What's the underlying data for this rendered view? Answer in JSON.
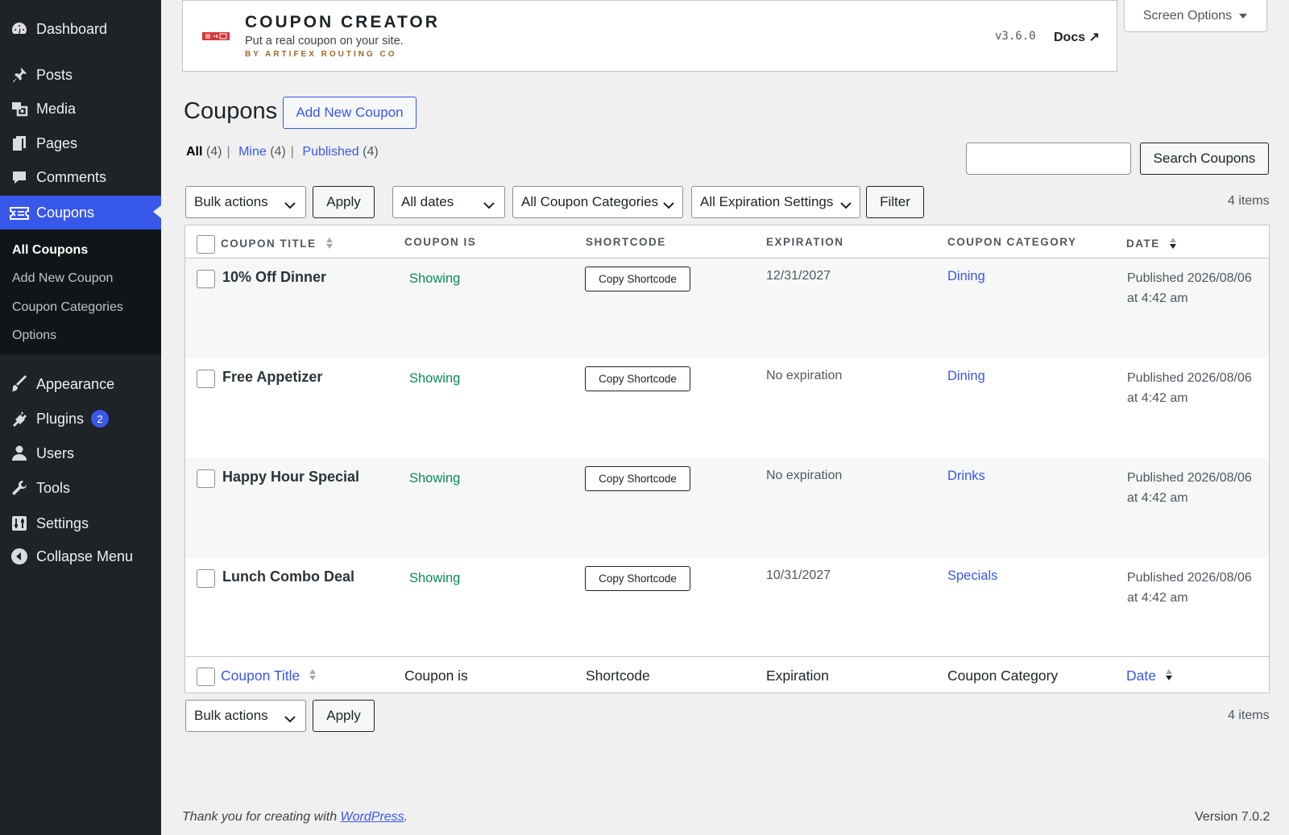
{
  "sidebar": {
    "menu": [
      {
        "label": "Dashboard",
        "icon": "dashboard-icon"
      },
      {
        "label": "Posts",
        "icon": "pin-icon"
      },
      {
        "label": "Media",
        "icon": "media-icon"
      },
      {
        "label": "Pages",
        "icon": "pages-icon"
      },
      {
        "label": "Comments",
        "icon": "comment-icon"
      },
      {
        "label": "Coupons",
        "icon": "ticket-icon",
        "active": true
      },
      {
        "label": "Appearance",
        "icon": "brush-icon"
      },
      {
        "label": "Plugins",
        "icon": "plug-icon",
        "badge": "2"
      },
      {
        "label": "Users",
        "icon": "user-icon"
      },
      {
        "label": "Tools",
        "icon": "wrench-icon"
      },
      {
        "label": "Settings",
        "icon": "settings-icon"
      },
      {
        "label": "Collapse Menu",
        "icon": "collapse-icon"
      }
    ],
    "submenu": [
      "All Coupons",
      "Add New Coupon",
      "Coupon Categories",
      "Options"
    ]
  },
  "banner": {
    "title": "COUPON CREATOR",
    "tagline": "Put a real coupon on your site.",
    "byline": "BY ARTIFEX ROUTING CO",
    "version": "v3.6.0",
    "docs": "Docs ↗"
  },
  "screen_options": "Screen Options",
  "page": {
    "title": "Coupons",
    "add_new": "Add New Coupon"
  },
  "views": {
    "all": "All",
    "all_count": "(4)",
    "mine": "Mine",
    "mine_count": "(4)",
    "published": "Published",
    "published_count": "(4)"
  },
  "search": {
    "value": "",
    "button": "Search Coupons"
  },
  "filters": {
    "bulk_actions": "Bulk actions",
    "apply": "Apply",
    "dates": "All dates",
    "categories": "All Coupon Categories",
    "expiration": "All Expiration Settings",
    "filter": "Filter"
  },
  "items_count": "4 items",
  "table": {
    "headers": [
      "COUPON TITLE",
      "COUPON IS",
      "SHORTCODE",
      "EXPIRATION",
      "COUPON CATEGORY",
      "DATE"
    ],
    "footers": [
      "Coupon Title",
      "Coupon is",
      "Shortcode",
      "Expiration",
      "Coupon Category",
      "Date"
    ],
    "rows": [
      {
        "title": "10% Off Dinner",
        "status": "Showing",
        "shortcode": "Copy Shortcode",
        "expiration": "12/31/2027",
        "category": "Dining",
        "date": "Published 2026/08/06 at 4:42 am"
      },
      {
        "title": "Free Appetizer",
        "status": "Showing",
        "shortcode": "Copy Shortcode",
        "expiration": "No expiration",
        "category": "Dining",
        "date": "Published 2026/08/06 at 4:42 am"
      },
      {
        "title": "Happy Hour Special",
        "status": "Showing",
        "shortcode": "Copy Shortcode",
        "expiration": "No expiration",
        "category": "Drinks",
        "date": "Published 2026/08/06 at 4:42 am"
      },
      {
        "title": "Lunch Combo Deal",
        "status": "Showing",
        "shortcode": "Copy Shortcode",
        "expiration": "10/31/2027",
        "category": "Specials",
        "date": "Published 2026/08/06 at 4:42 am"
      }
    ]
  },
  "footer": {
    "thanks_prefix": "Thank you for creating with ",
    "thanks_link": "WordPress",
    "thanks_suffix": ".",
    "version": "Version 7.0.2"
  },
  "colors": {
    "sidebar_bg": "#1d2327",
    "accent": "#3858e9",
    "status_green": "#0a8a5b",
    "byline_gold": "#a1682a"
  }
}
